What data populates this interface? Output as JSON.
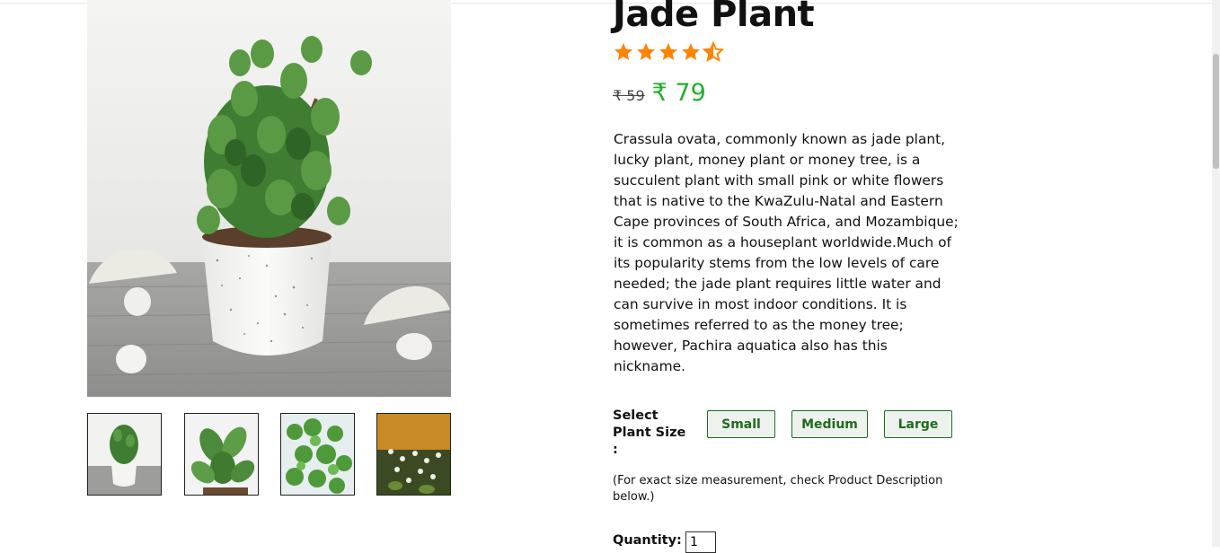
{
  "product": {
    "title": "Jade Plant",
    "rating_stars": 4.5,
    "old_price": "₹ 59",
    "new_price": "₹ 79",
    "description": "Crassula ovata, commonly known as jade plant, lucky plant, money plant or money tree, is a succulent plant with small pink or white flowers that is native to the KwaZulu-Natal and Eastern Cape provinces of South Africa, and Mozambique; it is common as a houseplant worldwide.Much of its popularity stems from the low levels of care needed; the jade plant requires little water and can survive in most indoor conditions. It is sometimes referred to as the money tree; however, Pachira aquatica also has this nickname."
  },
  "colors": {
    "star": "#ff8400",
    "price_green": "#22b02c",
    "button_green": "#1f6b1f"
  },
  "size_selector": {
    "label": "Select Plant Size :",
    "options": [
      "Small",
      "Medium",
      "Large"
    ],
    "note": "(For exact size measurement, check Product Description below.)"
  },
  "quantity": {
    "label": "Quantity:",
    "value": "1"
  },
  "gallery": {
    "thumbnails": [
      "jade-plant-pot-thumbnail",
      "jade-leaves-closeup-thumbnail",
      "jade-foliage-thumbnail",
      "jade-flowering-thumbnail"
    ]
  }
}
